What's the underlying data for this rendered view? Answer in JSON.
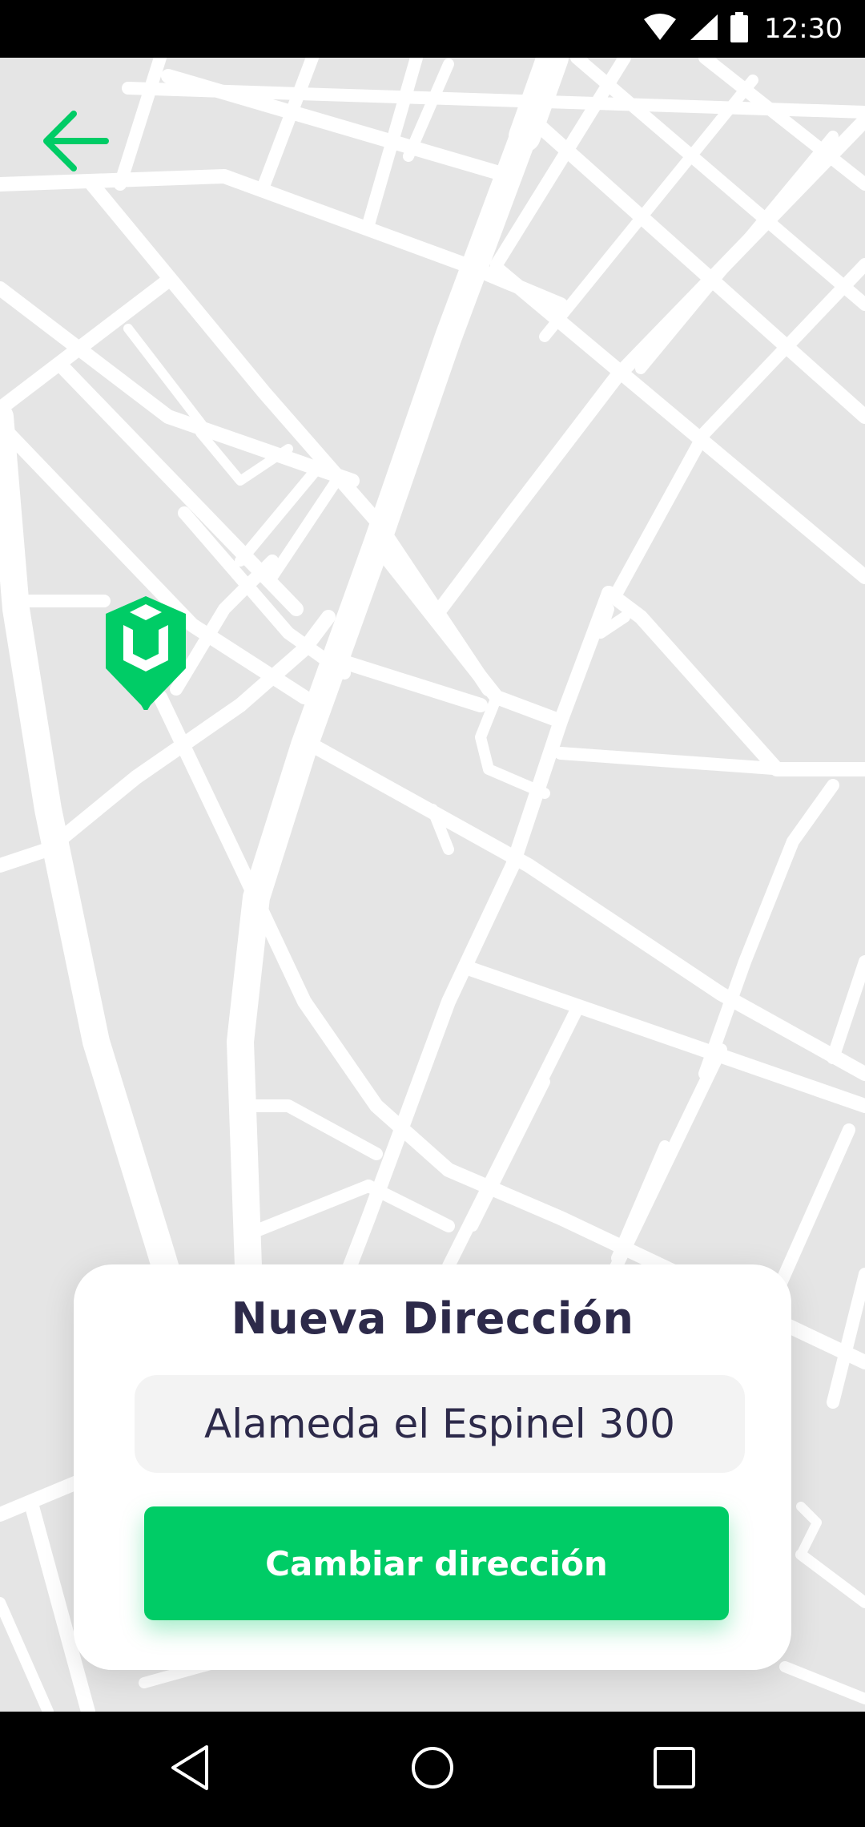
{
  "status_bar": {
    "time": "12:30",
    "icons": [
      "wifi-icon",
      "cellular-signal-icon",
      "battery-icon"
    ]
  },
  "header": {
    "back_icon": "arrow-left-icon"
  },
  "map": {
    "marker_icon": "location-pin-icon"
  },
  "card": {
    "title": "Nueva Dirección",
    "address_value": "Alameda el Espinel 300",
    "button_label": "Cambiar dirección"
  },
  "nav_bar": {
    "buttons": [
      "back-triangle-icon",
      "home-circle-icon",
      "recents-square-icon"
    ]
  },
  "colors": {
    "accent": "#00cc66",
    "title_text": "#2d2a4a",
    "map_background": "#e5e5e5",
    "map_roads": "#ffffff",
    "field_background": "#f3f3f3"
  }
}
